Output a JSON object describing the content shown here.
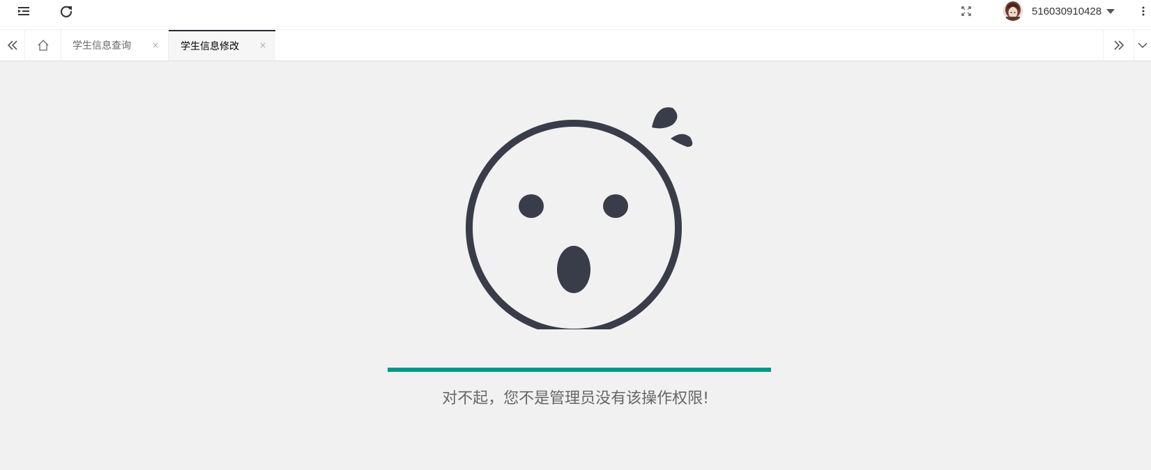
{
  "header": {
    "menu_toggle_icon": "indent-icon",
    "refresh_icon": "refresh-icon",
    "fullscreen_icon": "fullscreen-icon",
    "avatar_icon": "avatar",
    "username": "516030910428",
    "dropdown_icon": "caret-down-icon",
    "more_icon": "more-vertical-icon"
  },
  "tabbar": {
    "scroll_left_icon": "double-chevron-left-icon",
    "home_icon": "home-icon",
    "tabs": [
      {
        "label": "学生信息查询",
        "active": false
      },
      {
        "label": "学生信息修改",
        "active": true
      }
    ],
    "close_glyph": "×",
    "scroll_right_icon": "double-chevron-right-icon",
    "dropdown_icon": "chevron-down-icon"
  },
  "main": {
    "illustration": "surprised-face-icon",
    "progress_percent": 100,
    "progress_color": "#009688",
    "message": "对不起，您不是管理员没有该操作权限!"
  }
}
